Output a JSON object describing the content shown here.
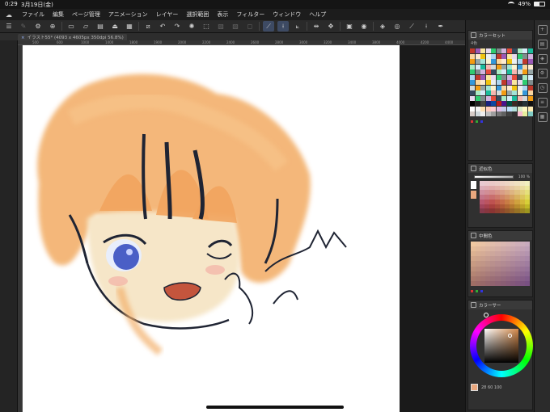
{
  "status": {
    "time": "0:29",
    "date": "3月19日(金)",
    "battery": "49%"
  },
  "menu": {
    "items": [
      "ファイル",
      "編集",
      "ページ管理",
      "アニメーション",
      "レイヤー",
      "選択範囲",
      "表示",
      "フィルター",
      "ウィンドウ",
      "ヘルプ"
    ]
  },
  "tab": {
    "title": "イラスト55* (4093 x 4605px 350dpi 56.8%)"
  },
  "ruler": {
    "ticks": [
      "500",
      "600",
      "1000",
      "1400",
      "1800",
      "1900",
      "2000",
      "2200",
      "2400",
      "2600",
      "2800",
      "3000",
      "3200",
      "3400",
      "3800",
      "4000",
      "4200",
      "4400"
    ]
  },
  "panels": {
    "color_set_title": "カラーセット",
    "color_set_sub": "4色",
    "approx_title": "近似色",
    "approx_value": "100 %",
    "approx_side": "100 %",
    "intermediate_title": "中間色",
    "color_circle_title": "カラーサー",
    "wheel_values": "28  60  100"
  },
  "colors": {
    "accent": "#3d4a63",
    "current_color": "#e9a77e"
  },
  "icons": [
    "settings-icon",
    "new-file-icon",
    "open-icon",
    "save-icon",
    "undo-icon",
    "redo-icon",
    "transform-icon",
    "brush-icon",
    "flip-icon",
    "layer-icon",
    "pen-icon"
  ]
}
